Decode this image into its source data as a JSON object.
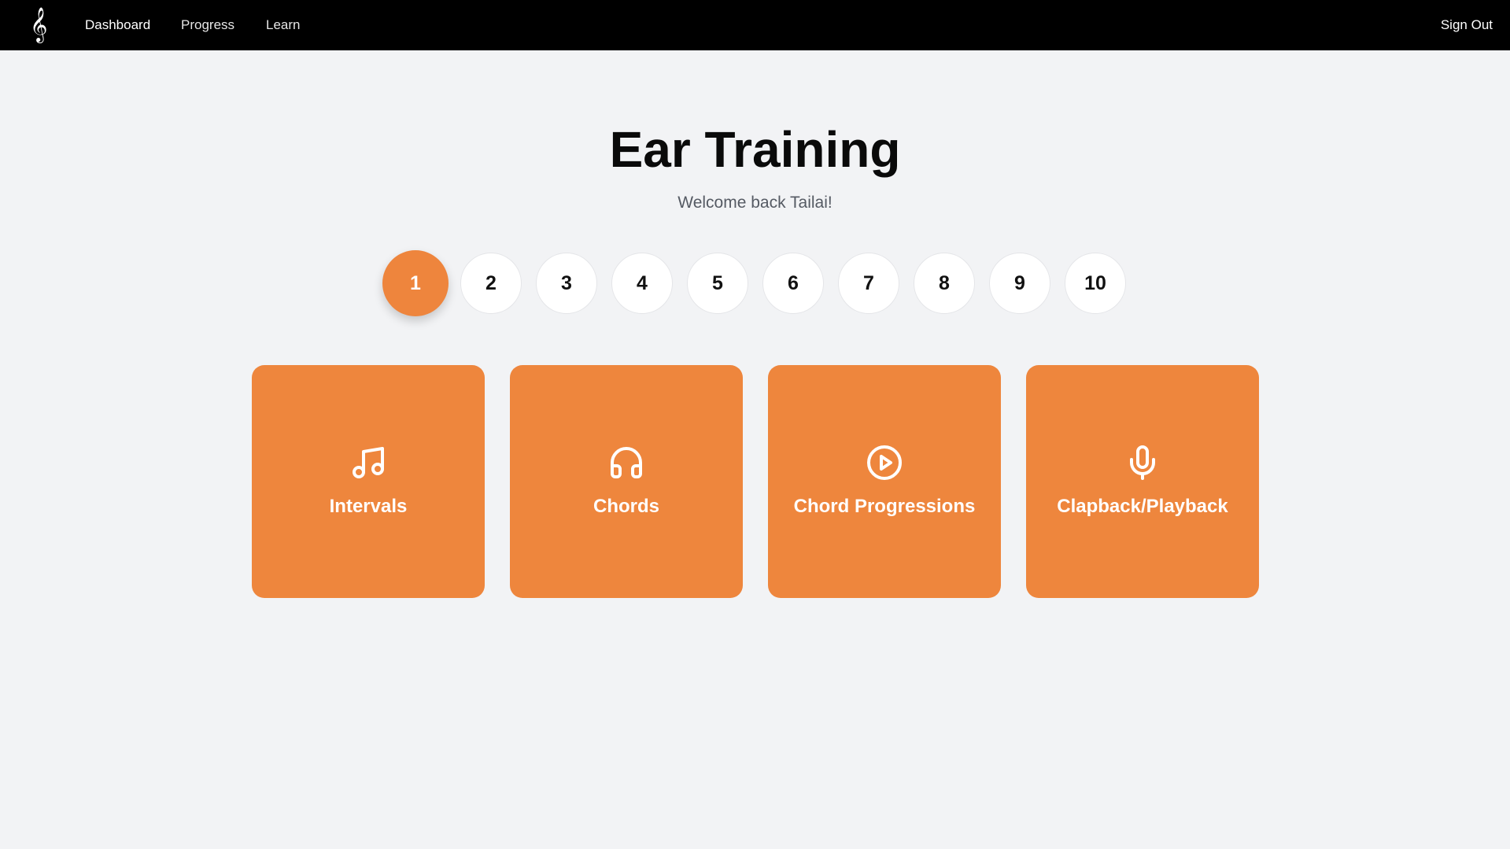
{
  "nav": {
    "logo_glyph": "𝄞",
    "logo_icon": "treble-clef-icon",
    "links": [
      "Dashboard",
      "Progress",
      "Learn"
    ],
    "active": "Dashboard",
    "sign_out": "Sign Out"
  },
  "header": {
    "title": "Ear Training",
    "subtitle": "Welcome back Tailai!"
  },
  "levels": {
    "items": [
      "1",
      "2",
      "3",
      "4",
      "5",
      "6",
      "7",
      "8",
      "9",
      "10"
    ],
    "selected": "1"
  },
  "cards": [
    {
      "label": "Intervals",
      "icon": "music-note-icon"
    },
    {
      "label": "Chords",
      "icon": "headphones-icon"
    },
    {
      "label": "Chord Progressions",
      "icon": "play-circle-icon"
    },
    {
      "label": "Clapback/Playback",
      "icon": "microphone-icon"
    }
  ],
  "colors": {
    "accent": "#ee853d",
    "nav_bg": "#000000",
    "page_bg": "#f2f3f5"
  }
}
